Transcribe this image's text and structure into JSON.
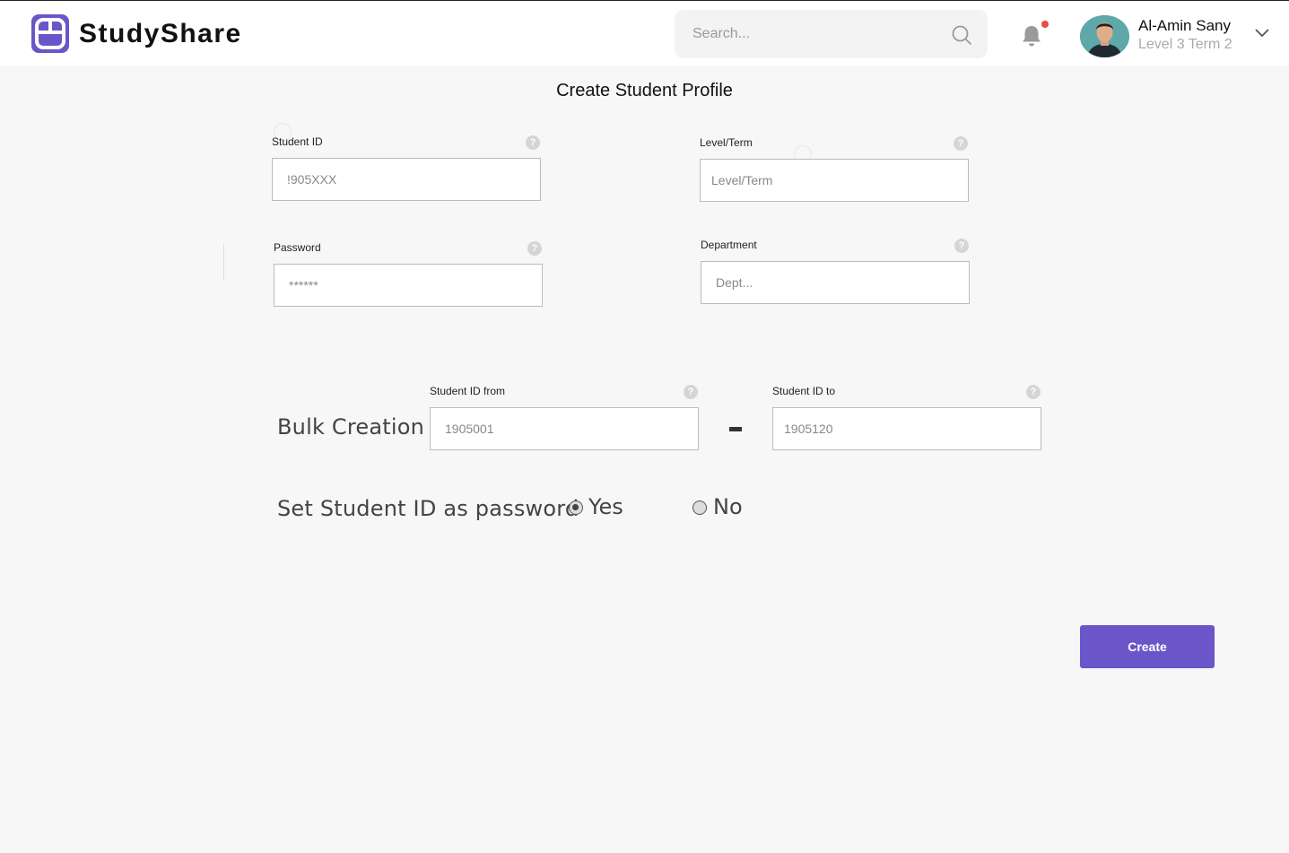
{
  "app": {
    "brand": "StudyShare",
    "accent_color": "#6a55c9",
    "logo_icon": "studyshare-logo-icon"
  },
  "header": {
    "search_placeholder": "Search...",
    "search_icon": "search-icon",
    "notification_icon": "bell-icon",
    "notification_dot_color": "#e74c3c",
    "user": {
      "name": "Al-Amin Sany",
      "level": "Level 3 Term 2",
      "menu_icon": "chevron-down-icon"
    }
  },
  "form": {
    "title": "Create Student Profile",
    "help_glyph": "?",
    "student_id": {
      "label": "Student ID",
      "placeholder": "!905XXX"
    },
    "level_term": {
      "label": "Level/Term",
      "placeholder": "Level/Term"
    },
    "password": {
      "label": "Password",
      "placeholder": "******"
    },
    "department": {
      "label": "Department",
      "placeholder": "Dept..."
    }
  },
  "bulk": {
    "section_label": "Bulk Creation",
    "id_from": {
      "label": "Student ID from",
      "placeholder": "1905001"
    },
    "id_to": {
      "label": "Student ID to",
      "placeholder": "1905120"
    }
  },
  "password_option": {
    "label": "Set Student ID as password",
    "options": [
      {
        "label": "Yes",
        "selected": true
      },
      {
        "label": "No",
        "selected": false
      }
    ]
  },
  "actions": {
    "create_label": "Create"
  }
}
